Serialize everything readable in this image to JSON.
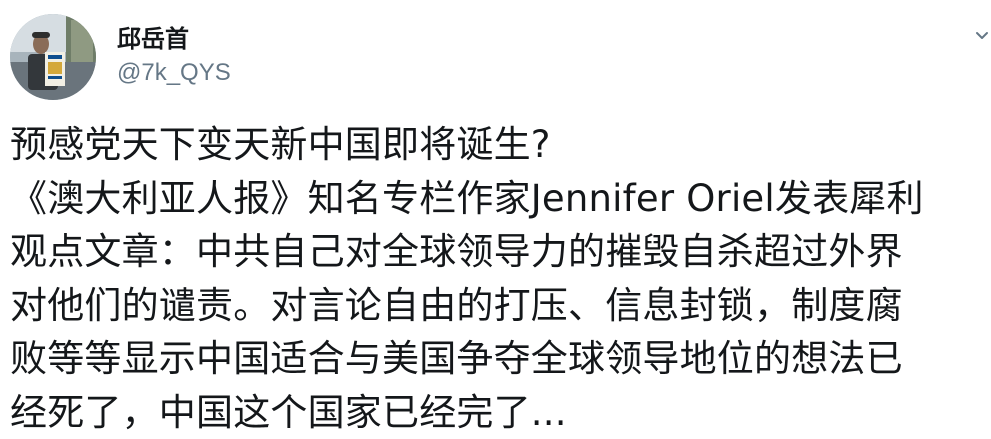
{
  "author": {
    "display_name": "邱岳首",
    "handle": "@7k_QYS"
  },
  "icons": {
    "avatar": "profile-photo",
    "menu": "chevron-down-icon"
  },
  "tweet": {
    "lines": [
      "预感党天下变天新中国即将诞生?",
      "《澳大利亚人报》知名专栏作家Jennifer Oriel发表犀利",
      "观点文章：中共自己对全球领导力的摧毁自杀超过外界",
      "对他们的谴责。对言论自由的打压、信息封锁，制度腐",
      "败等等显示中国适合与美国争夺全球领导地位的想法已",
      "经死了，中国这个国家已经完了..."
    ]
  },
  "colors": {
    "text": "#14171a",
    "secondary_text": "#657786",
    "background": "#ffffff"
  }
}
